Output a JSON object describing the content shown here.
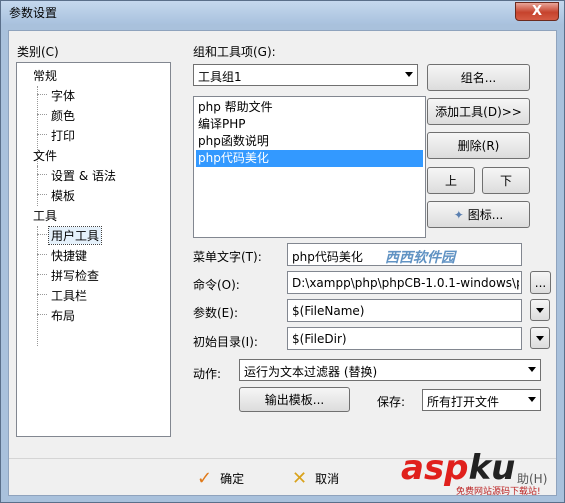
{
  "window": {
    "title": "参数设置",
    "close": "X"
  },
  "category": {
    "label": "类别(C)",
    "items": [
      "常规",
      "字体",
      "颜色",
      "打印",
      "文件",
      "设置 & 语法",
      "模板",
      "工具",
      "用户工具",
      "快捷键",
      "拼写检查",
      "工具栏",
      "布局"
    ]
  },
  "toolgroup": {
    "label": "组和工具项(G):",
    "selected": "工具组1",
    "tools": [
      "php 帮助文件",
      "编译PHP",
      "php函数说明",
      "php代码美化"
    ],
    "name_button": "组名...",
    "add_tool_button": "添加工具(D)>>",
    "delete_button": "删除(R)",
    "up_button": "上",
    "down_button": "下",
    "icon_button": "图标..."
  },
  "fields": {
    "menu_text_label": "菜单文字(T):",
    "menu_text_value": "php代码美化",
    "command_label": "命令(O):",
    "command_value": "D:\\xampp\\php\\phpCB-1.0.1-windows\\p",
    "browse_button": "...",
    "args_label": "参数(E):",
    "args_value": "$(FileName)",
    "initdir_label": "初始目录(I):",
    "initdir_value": "$(FileDir)"
  },
  "action": {
    "label": "动作:",
    "selected": "运行为文本过滤器 (替换)",
    "output_template_button": "输出模板...",
    "save_label": "保存:",
    "save_selected": "所有打开文件"
  },
  "footer": {
    "ok": "确定",
    "cancel": "取消"
  },
  "watermark": {
    "site1": "西西软件园",
    "site2": "asp",
    "site3": "ku",
    "caption": "免费网站源码下载站!",
    "partial": "助(H)"
  }
}
